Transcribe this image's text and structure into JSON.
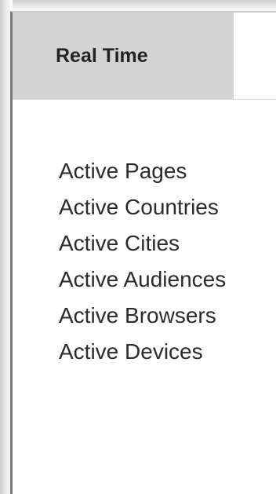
{
  "tabs": {
    "active_label": "Real Time"
  },
  "menu": {
    "items": [
      {
        "label": "Active Pages"
      },
      {
        "label": "Active Countries"
      },
      {
        "label": "Active Cities"
      },
      {
        "label": "Active Audiences"
      },
      {
        "label": "Active Browsers"
      },
      {
        "label": "Active Devices"
      }
    ]
  },
  "colors": {
    "tab_active_bg": "#d3d3d3",
    "text": "#2b2b2b",
    "panel_bg": "#ffffff"
  }
}
